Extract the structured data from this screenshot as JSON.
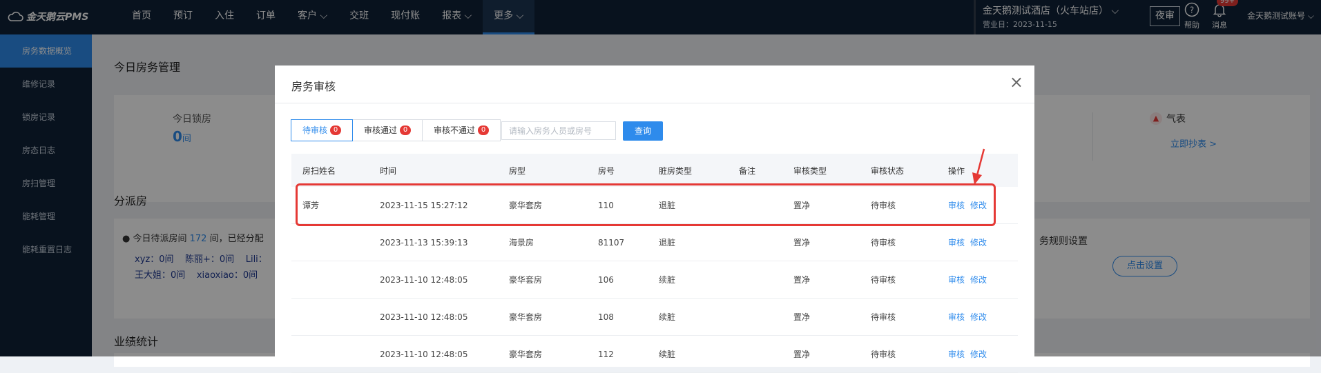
{
  "app": {
    "logo_text": "金天鹅云PMS",
    "nav": [
      "首页",
      "预订",
      "入住",
      "订单",
      "客户",
      "交班",
      "现付账",
      "报表",
      "更多"
    ],
    "nav_dropdown_items": [
      "客户",
      "报表",
      "更多"
    ],
    "active_nav": "更多",
    "hotel_name": "金天鹅测试酒店（火车站店）",
    "business_date": "营业日：2023-11-15",
    "night_audit_label": "夜审",
    "help_label": "帮助",
    "message_label": "消息",
    "message_badge": "99+",
    "account_name": "金天鹅测试账号"
  },
  "sidebar": {
    "items": [
      "房务数据概览",
      "维修记录",
      "锁房记录",
      "房态日志",
      "房扫管理",
      "能耗管理",
      "能耗重置日志"
    ],
    "active_index": 0
  },
  "background": {
    "section_today": "今日房务管理",
    "locked_label": "今日锁房",
    "locked_value": "0",
    "locked_unit": "间",
    "meter_label": "气表",
    "meter_link": "立即抄表 >",
    "section_assign": "分派房",
    "assign_line_prefix": "今日待派房间",
    "assign_count": "172",
    "assign_line_suffix": "间，已经分配",
    "assign_people_row1": [
      "xyz：0间",
      "陈丽+：0间",
      "Lili："
    ],
    "assign_people_row2": [
      "王大姐：0间",
      "xiaoxiao：0间"
    ],
    "rule_settings": "务规则设置",
    "click_settings": "点击设置",
    "section_performance": "业绩统计"
  },
  "modal": {
    "title": "房务审核",
    "close_symbol": "×",
    "tabs": [
      {
        "label": "待审核",
        "count": "0",
        "active": true
      },
      {
        "label": "审核通过",
        "count": "0",
        "active": false
      },
      {
        "label": "审核不通过",
        "count": "0",
        "active": false
      }
    ],
    "search_placeholder": "请输入房务人员或房号",
    "query_label": "查询",
    "columns": [
      "房扫姓名",
      "时间",
      "房型",
      "房号",
      "脏房类型",
      "备注",
      "审核类型",
      "审核状态",
      "操作"
    ],
    "action_review": "审核",
    "action_edit": "修改",
    "rows": [
      {
        "name": "谭芳",
        "time": "2023-11-15 15:27:12",
        "room_type": "豪华套房",
        "room_no": "110",
        "dirty_type": "退脏",
        "remark": "",
        "review_type": "置净",
        "review_status": "待审核"
      },
      {
        "name": "",
        "time": "2023-11-13 15:39:13",
        "room_type": "海景房",
        "room_no": "81107",
        "dirty_type": "退脏",
        "remark": "",
        "review_type": "置净",
        "review_status": "待审核"
      },
      {
        "name": "",
        "time": "2023-11-10 12:48:05",
        "room_type": "豪华套房",
        "room_no": "106",
        "dirty_type": "续脏",
        "remark": "",
        "review_type": "置净",
        "review_status": "待审核"
      },
      {
        "name": "",
        "time": "2023-11-10 12:48:05",
        "room_type": "豪华套房",
        "room_no": "108",
        "dirty_type": "续脏",
        "remark": "",
        "review_type": "置净",
        "review_status": "待审核"
      },
      {
        "name": "",
        "time": "2023-11-10 12:48:05",
        "room_type": "豪华套房",
        "room_no": "112",
        "dirty_type": "续脏",
        "remark": "",
        "review_type": "置净",
        "review_status": "待审核"
      }
    ]
  },
  "colors": {
    "topbar": "#0f2137",
    "accent": "#2e8bec",
    "highlight": "#e53935"
  }
}
